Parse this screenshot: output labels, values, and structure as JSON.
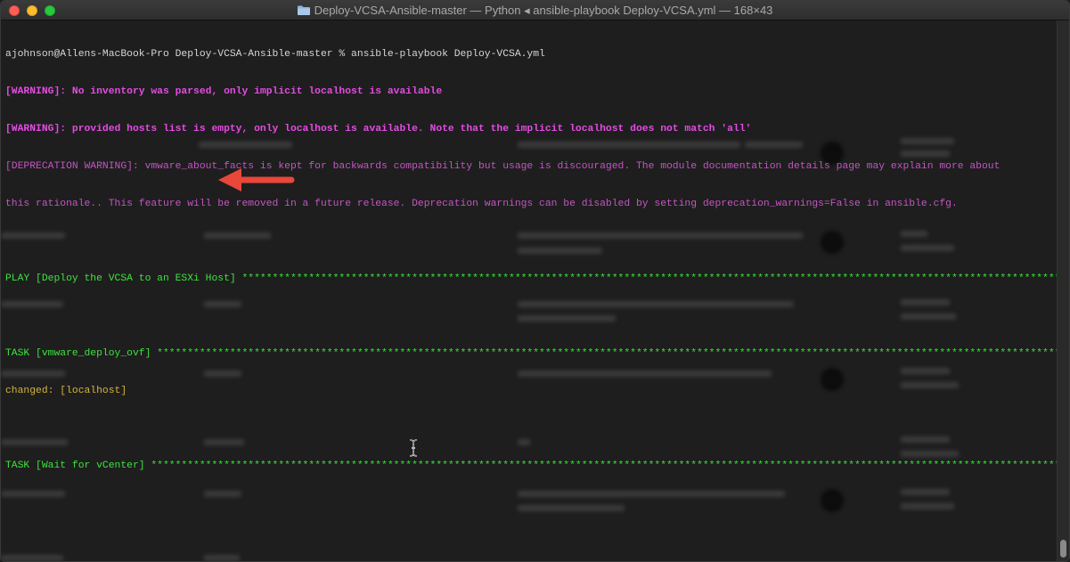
{
  "window": {
    "title": "Deploy-VCSA-Ansible-master — Python ◂ ansible-playbook Deploy-VCSA.yml — 168×43"
  },
  "terminal": {
    "prompt": "ajohnson@Allens-MacBook-Pro Deploy-VCSA-Ansible-master % ansible-playbook Deploy-VCSA.yml",
    "warning1": "[WARNING]: No inventory was parsed, only implicit localhost is available",
    "warning2": "[WARNING]: provided hosts list is empty, only localhost is available. Note that the implicit localhost does not match 'all'",
    "deprecation1": "[DEPRECATION WARNING]: vmware_about_facts is kept for backwards compatibility but usage is discouraged. The module documentation details page may explain more about",
    "deprecation2": "this rationale.. This feature will be removed in a future release. Deprecation warnings can be disabled by setting deprecation_warnings=False in ansible.cfg.",
    "play": "PLAY [Deploy the VCSA to an ESXi Host] *************************************************************************************************************************************************",
    "task1": "TASK [vmware_deploy_ovf] ***********************************************************************************************************************************************************",
    "changed": "changed: [localhost]",
    "task2": "TASK [Wait for vCenter] ************************************************************************************************************************************************************"
  },
  "colors": {
    "warning": "#e34ce3",
    "ok_green": "#3ee33e",
    "changed_yellow": "#d4b53e",
    "annotation_arrow": "#e8473a"
  },
  "icons": {
    "title_icon": "folder-icon",
    "annotation": "arrow-left-icon",
    "cursor": "text-cursor-icon"
  }
}
